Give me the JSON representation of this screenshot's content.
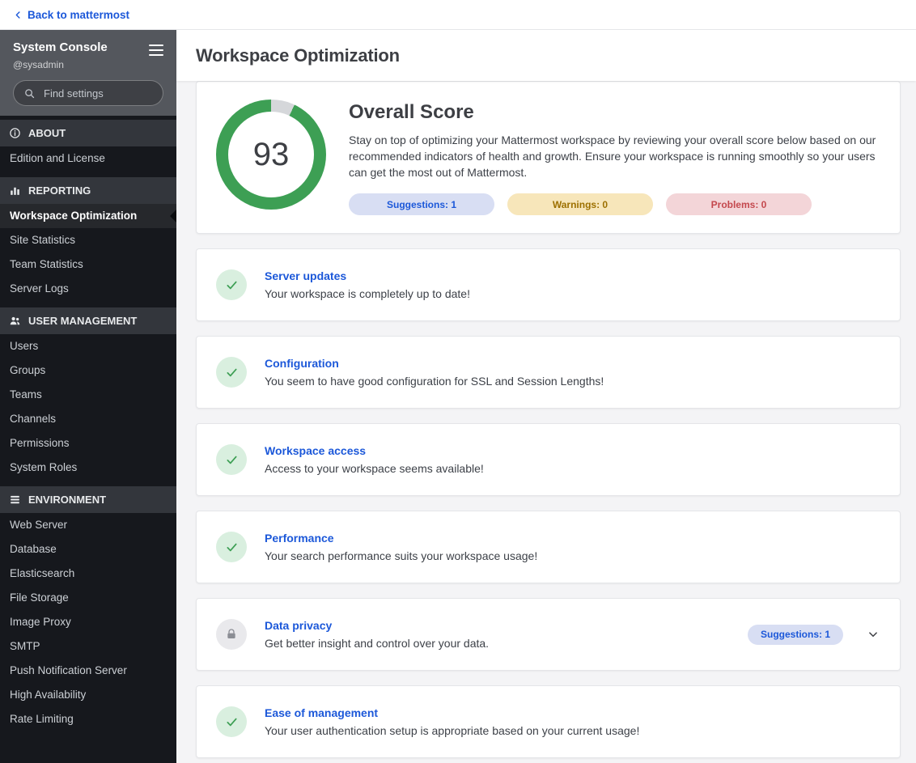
{
  "colors": {
    "accent": "#1c58d9",
    "success": "#3d9f54",
    "success-bg": "#d9efdf",
    "warning-text": "#9d7000",
    "warning-bg": "#f7e6ba",
    "danger-text": "#c4484d",
    "danger-bg": "#f3d5d8",
    "suggestion-bg": "#d8def3",
    "sidebar-bg": "#16181d",
    "sidebar-section-bg": "#33363c",
    "sidebar-header-bg": "#54575d",
    "content-bg": "#f4f4f6"
  },
  "top_bar": {
    "back_link": "Back to mattermost"
  },
  "sidebar": {
    "title": "System Console",
    "subtitle": "@sysadmin",
    "search_placeholder": "Find settings",
    "sections": [
      {
        "label": "ABOUT",
        "icon": "info-icon",
        "items": [
          {
            "label": "Edition and License"
          }
        ]
      },
      {
        "label": "REPORTING",
        "icon": "bar-chart-icon",
        "items": [
          {
            "label": "Workspace Optimization",
            "active": true
          },
          {
            "label": "Site Statistics"
          },
          {
            "label": "Team Statistics"
          },
          {
            "label": "Server Logs"
          }
        ]
      },
      {
        "label": "USER MANAGEMENT",
        "icon": "users-icon",
        "items": [
          {
            "label": "Users"
          },
          {
            "label": "Groups"
          },
          {
            "label": "Teams"
          },
          {
            "label": "Channels"
          },
          {
            "label": "Permissions"
          },
          {
            "label": "System Roles"
          }
        ]
      },
      {
        "label": "ENVIRONMENT",
        "icon": "server-stack-icon",
        "items": [
          {
            "label": "Web Server"
          },
          {
            "label": "Database"
          },
          {
            "label": "Elasticsearch"
          },
          {
            "label": "File Storage"
          },
          {
            "label": "Image Proxy"
          },
          {
            "label": "SMTP"
          },
          {
            "label": "Push Notification Server"
          },
          {
            "label": "High Availability"
          },
          {
            "label": "Rate Limiting"
          }
        ]
      }
    ]
  },
  "header": {
    "title": "Workspace Optimization"
  },
  "overview": {
    "score": "93",
    "title": "Overall Score",
    "description": "Stay on top of optimizing your Mattermost workspace by reviewing your overall score below based on our recommended indicators of health and growth. Ensure your workspace is running smoothly so your users can get the most out of Mattermost.",
    "chips": {
      "suggestions": "Suggestions: 1",
      "warnings": "Warnings: 0",
      "problems": "Problems: 0"
    }
  },
  "cards": [
    {
      "title": "Server updates",
      "description": "Your workspace is completely up to date!",
      "status_icon": "check"
    },
    {
      "title": "Configuration",
      "description": "You seem to have good configuration for SSL and Session Lengths!",
      "status_icon": "check"
    },
    {
      "title": "Workspace access",
      "description": "Access to your workspace seems available!",
      "status_icon": "check"
    },
    {
      "title": "Performance",
      "description": "Your search performance suits your workspace usage!",
      "status_icon": "check"
    },
    {
      "title": "Data privacy",
      "description": "Get better insight and control over your data.",
      "status_icon": "lock",
      "chip": "Suggestions: 1"
    },
    {
      "title": "Ease of management",
      "description": "Your user authentication setup is appropriate based on your current usage!",
      "status_icon": "check"
    }
  ]
}
